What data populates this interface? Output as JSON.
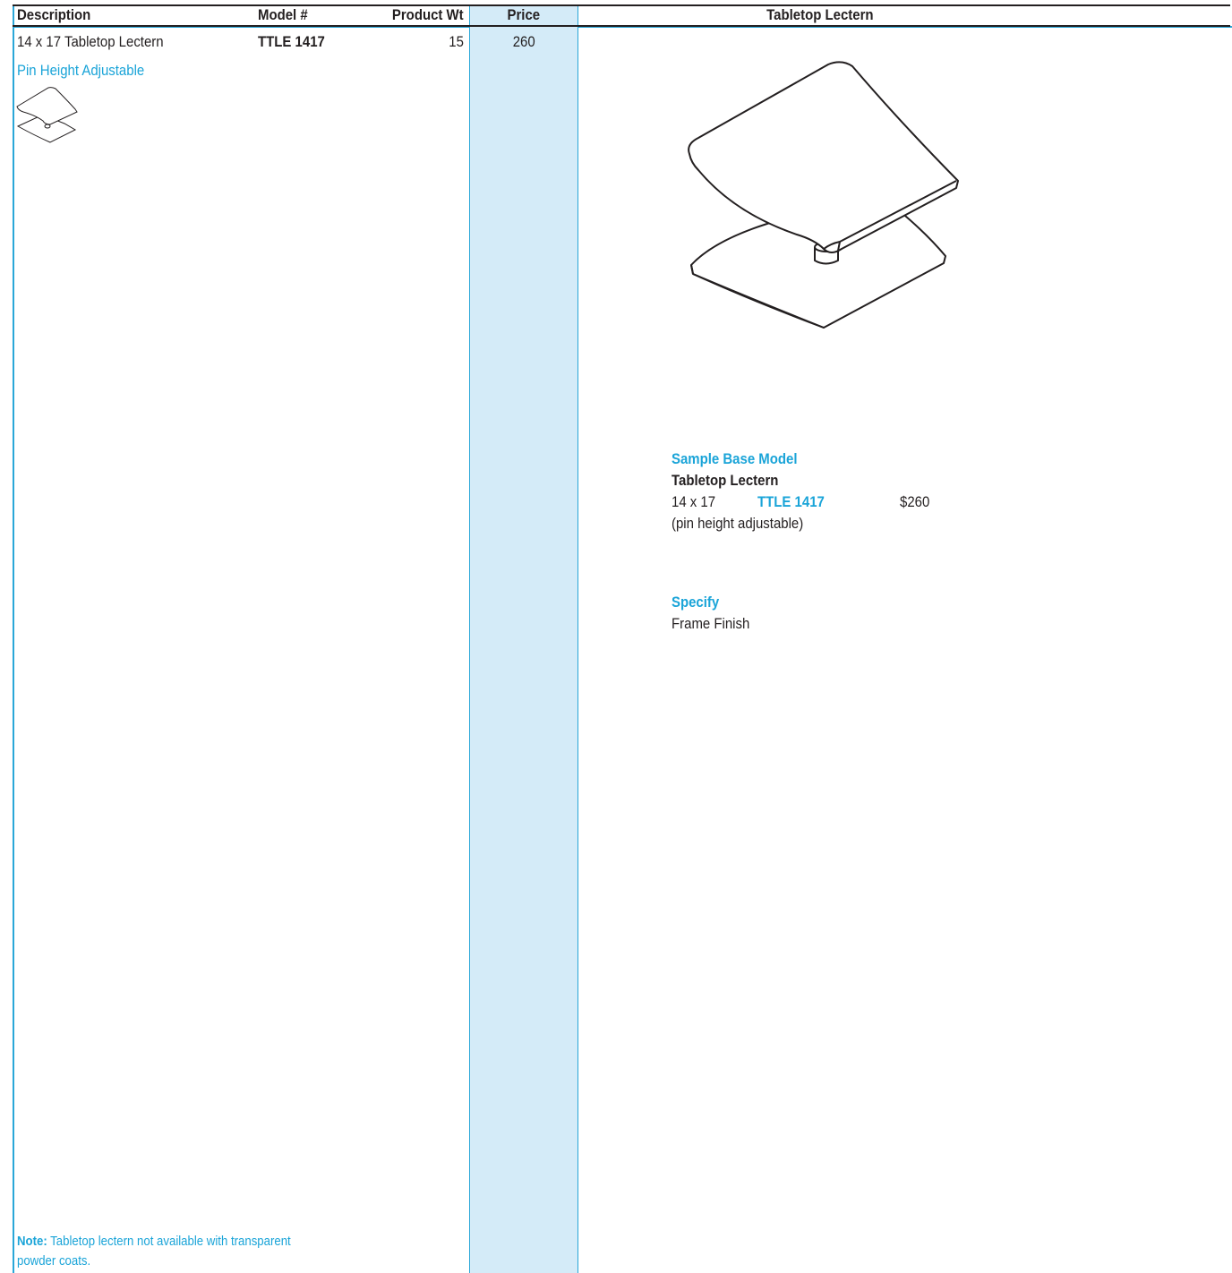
{
  "header": {
    "description": "Description",
    "model": "Model #",
    "weight": "Product Wt",
    "price": "Price",
    "section_title": "Tabletop Lectern"
  },
  "row": {
    "description": "14 x 17 Tabletop Lectern",
    "model": "TTLE 1417",
    "weight": "15",
    "price": "260"
  },
  "option_label": "Pin Height Adjustable",
  "sample": {
    "heading": "Sample Base Model",
    "product": "Tabletop Lectern",
    "size": "14 x 17",
    "model": "TTLE 1417",
    "price": "$260",
    "note": "(pin height adjustable)"
  },
  "specify": {
    "heading": "Specify",
    "item": "Frame Finish"
  },
  "footnote": {
    "label": "Note:",
    "text_line1": " Tabletop lectern not available with transparent",
    "text_line2": "powder coats."
  },
  "colors": {
    "accent": "#1aa4d8",
    "price_column": "#d4ebf8",
    "text": "#231f20"
  },
  "icons": [
    "lectern-thumbnail-icon",
    "lectern-illustration"
  ]
}
